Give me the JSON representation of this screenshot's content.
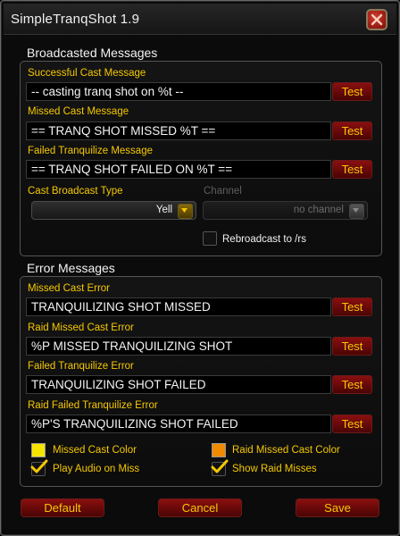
{
  "window": {
    "title": "SimpleTranqShot 1.9"
  },
  "broadcast": {
    "heading": "Broadcasted Messages",
    "test_label": "Test",
    "rows": [
      {
        "label": "Successful Cast Message",
        "value": "-- casting tranq shot on %t --"
      },
      {
        "label": "Missed Cast Message",
        "value": "== TRANQ SHOT MISSED %T =="
      },
      {
        "label": "Failed Tranquilize Message",
        "value": "== TRANQ SHOT FAILED ON %T =="
      }
    ],
    "type": {
      "label": "Cast Broadcast Type",
      "value": "Yell"
    },
    "channel": {
      "label": "Channel",
      "value": "no channel"
    },
    "rebroadcast": {
      "label": "Rebroadcast to /rs",
      "checked": false
    }
  },
  "errors": {
    "heading": "Error Messages",
    "test_label": "Test",
    "rows": [
      {
        "label": "Missed Cast Error",
        "value": "TRANQUILIZING SHOT MISSED"
      },
      {
        "label": "Raid Missed Cast Error",
        "value": "%P MISSED TRANQUILIZING SHOT"
      },
      {
        "label": "Failed Tranquilize Error",
        "value": "TRANQUILIZING SHOT FAILED"
      },
      {
        "label": "Raid Failed Tranquilize Error",
        "value": "%P'S TRANQUILIZING SHOT FAILED"
      }
    ],
    "missed_color": {
      "label": "Missed Cast Color",
      "color": "#f5e400"
    },
    "raid_missed_color": {
      "label": "Raid Missed Cast Color",
      "color": "#f08a00"
    },
    "play_audio": {
      "label": "Play Audio on Miss",
      "checked": true
    },
    "show_raid": {
      "label": "Show Raid Misses",
      "checked": true
    }
  },
  "buttons": {
    "default": "Default",
    "cancel": "Cancel",
    "save": "Save"
  },
  "colors": {
    "accent": "#f5c800",
    "button": "#6a0808"
  }
}
